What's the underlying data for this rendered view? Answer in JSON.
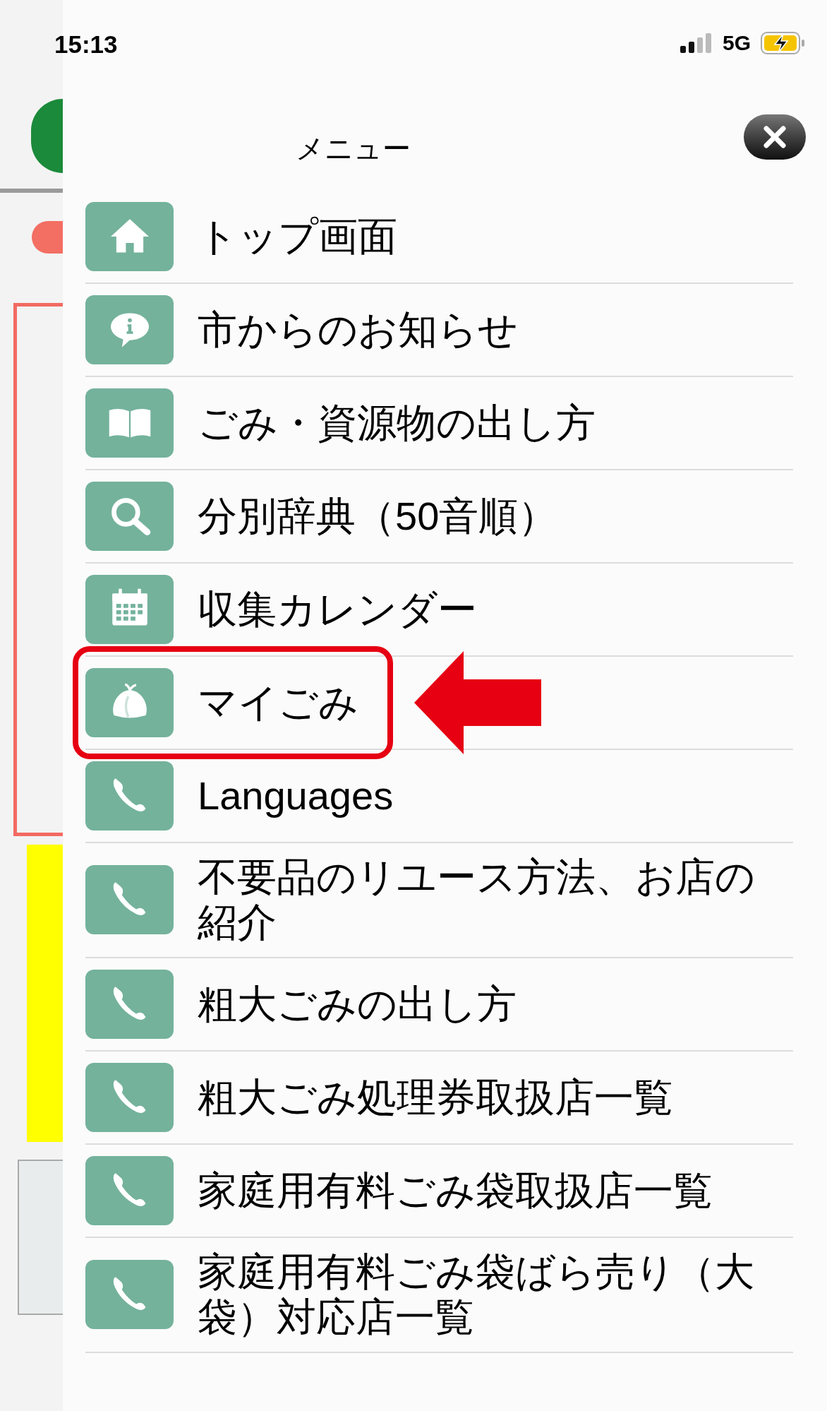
{
  "status_bar": {
    "time": "15:13",
    "network": "5G"
  },
  "menu": {
    "title": "メニュー",
    "items": [
      {
        "label": "トップ画面",
        "kind": "home",
        "highlighted": false
      },
      {
        "label": "市からのお知らせ",
        "kind": "notice",
        "highlighted": false
      },
      {
        "label": "ごみ・資源物の出し方",
        "kind": "guide",
        "highlighted": false
      },
      {
        "label": "分別辞典（50音順）",
        "kind": "dictionary",
        "highlighted": false
      },
      {
        "label": "収集カレンダー",
        "kind": "calendar",
        "highlighted": false
      },
      {
        "label": "マイごみ",
        "kind": "mygarbage",
        "highlighted": true
      },
      {
        "label": "Languages",
        "kind": "link",
        "highlighted": false
      },
      {
        "label": "不要品のリユース方法、お店の紹介",
        "kind": "link",
        "highlighted": false
      },
      {
        "label": "粗大ごみの出し方",
        "kind": "link",
        "highlighted": false
      },
      {
        "label": "粗大ごみ処理券取扱店一覧",
        "kind": "link",
        "highlighted": false
      },
      {
        "label": "家庭用有料ごみ袋取扱店一覧",
        "kind": "link",
        "highlighted": false
      },
      {
        "label": "家庭用有料ごみ袋ばら売り（大袋）対応店一覧",
        "kind": "link",
        "highlighted": false
      }
    ]
  }
}
